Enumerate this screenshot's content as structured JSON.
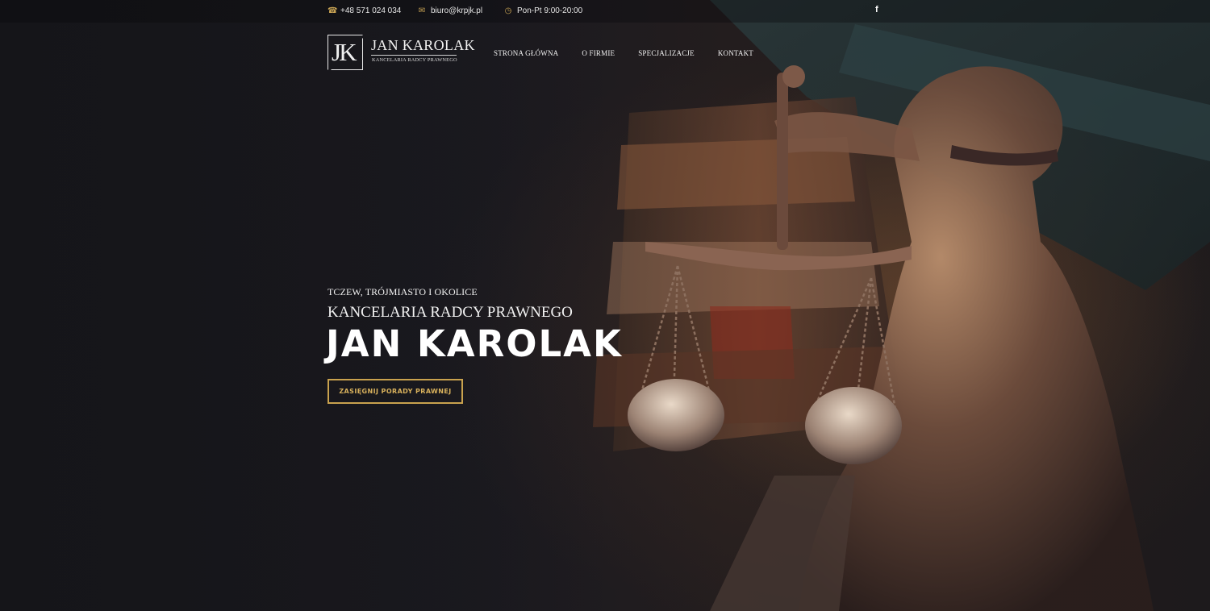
{
  "topbar": {
    "phone": "+48 571 024 034",
    "email": "biuro@krpjk.pl",
    "hours": "Pon-Pt 9:00-20:00",
    "phone_icon": "phone-icon",
    "email_icon": "envelope-icon",
    "hours_icon": "clock-icon",
    "social_icon": "facebook-icon",
    "social_label": "f"
  },
  "logo": {
    "monogram": "JK",
    "name": "JAN KAROLAK",
    "tagline": "KANCELARIA RADCY PRAWNEGO"
  },
  "nav": {
    "items": [
      "STRONA GŁÓWNA",
      "O FIRMIE",
      "SPECJALIZACJE",
      "KONTAKT"
    ]
  },
  "hero": {
    "kicker": "TCZEW, TRÓJMIASTO I OKOLICE",
    "subtitle": "KANCELARIA RADCY PRAWNEGO",
    "title": "JAN KAROLAK",
    "cta_label": "ZASIĘGNIJ PORADY PRAWNEJ"
  },
  "colors": {
    "accent": "#c9a24e",
    "background": "#17171c",
    "text": "#ffffff"
  }
}
